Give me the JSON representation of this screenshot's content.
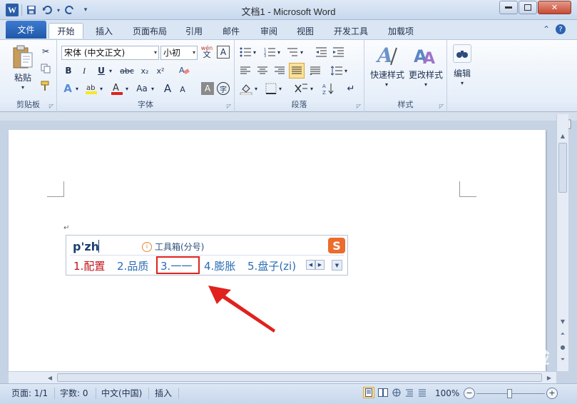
{
  "window": {
    "title": "文档1 - Microsoft Word",
    "app_logo": "W"
  },
  "tabs": {
    "file": "文件",
    "items": [
      "开始",
      "插入",
      "页面布局",
      "引用",
      "邮件",
      "审阅",
      "视图",
      "开发工具",
      "加载项"
    ]
  },
  "ribbon": {
    "clipboard": {
      "label": "剪贴板",
      "paste": "粘贴"
    },
    "font": {
      "label": "字体",
      "font_name": "宋体 (中文正文)",
      "font_size": "小初",
      "pinyin_guide": "wén",
      "bold": "B",
      "italic": "I",
      "underline": "U",
      "strike": "abc",
      "subscript": "x₂",
      "superscript": "x²",
      "grow": "A",
      "shrink": "A",
      "case": "Aa",
      "enclose": "字"
    },
    "paragraph": {
      "label": "段落"
    },
    "styles": {
      "label": "样式",
      "quick_styles": "快速样式",
      "change_styles": "更改样式"
    },
    "editing": {
      "label": "编辑"
    }
  },
  "document": {
    "paragraph_mark": "↵"
  },
  "ime": {
    "input": "p'zh",
    "tip": "工具箱(分号)",
    "logo": "S",
    "candidates": [
      {
        "index": "1.",
        "text": "配置"
      },
      {
        "index": "2.",
        "text": "品质"
      },
      {
        "index": "3.",
        "text": "一一"
      },
      {
        "index": "4.",
        "text": "膨胀"
      },
      {
        "index": "5.",
        "text": "盘子(zi)"
      }
    ],
    "highlighted_candidate": 3
  },
  "statusbar": {
    "page": "页面: 1/1",
    "words": "字数: 0",
    "language": "中文(中国)",
    "mode": "插入",
    "zoom": "100%",
    "zoom_level_percent": 100
  },
  "watermark": "Baidu 经验",
  "colors": {
    "accent": "#2a5da8",
    "highlight_box": "#e0211e",
    "arrow": "#e0211e",
    "candidate_first": "#c0141b",
    "candidate_other": "#2c6db3"
  }
}
